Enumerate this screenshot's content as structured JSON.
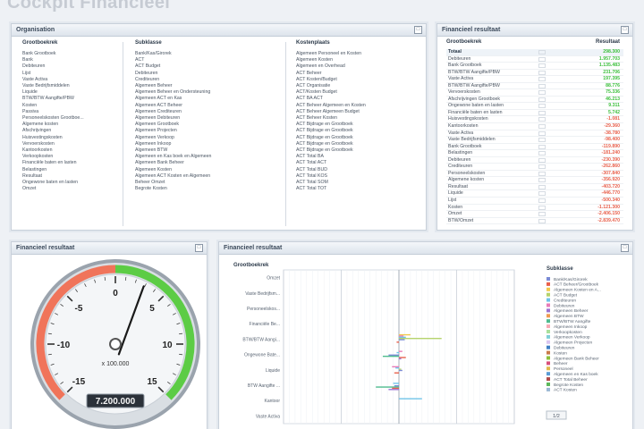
{
  "page": {
    "title": "Cockpit Financieel"
  },
  "organisation": {
    "title": "Organisation",
    "columns": [
      {
        "header": "Grootboekrek",
        "items": [
          "Bank Grootboek",
          "Bank",
          "Debiteuren",
          "Lijst",
          "Vaste Activa",
          "Vaste Bedrijfsmiddelen",
          "Liquide",
          "BTW/BTW Aangifte/PBW",
          "Kosten",
          "Passiva",
          "Personeelskosten Grootboe...",
          "Algemene kosten",
          "Afschrijvingen",
          "Huisvestingskosten",
          "Vervoerskosten",
          "Kantoorkosten",
          "Verkoopkosten",
          "Financiële baten en lasten",
          "Belastingen",
          "Resultaat",
          "Ongewone baten en lasten",
          "Omzet"
        ]
      },
      {
        "header": "Subklasse",
        "items": [
          "Bank/Kas/Girorek",
          "ACT",
          "ACT Budget",
          "Debiteuren",
          "Crediteuren",
          "Algemeen Beheer",
          "Algemeen Beheer en Ondersteuning",
          "Algemeen ACT en Kas",
          "Algemeen ACT Beheer",
          "Algemeen Crediteuren",
          "Algemeen Debiteuren",
          "Algemeen Grootboek",
          "Algemeen Projecten",
          "Algemeen Verkoop",
          "Algemeen Inkoop",
          "Algemeen BTW",
          "Algemeen en Kas boek en Algemeen",
          "Algemeen Bank Beheer",
          "Algemeen Kosten",
          "Algemeen ACT Kosten en Algemeen",
          "Beheer Omzet",
          "Begrote Kosten"
        ]
      },
      {
        "header": "Kostenplaats",
        "items": [
          "Algemeen Personeel en Kosten",
          "Algemeen Kosten",
          "Algemeen en Overhead",
          "ACT Beheer",
          "ACT Kosten/Budget",
          "ACT Organisatie",
          "ACT/Kosten Budget",
          "ACT BA ACT",
          "ACT Beheer Algemeen en Kosten",
          "ACT Beheer Algemeen Budget",
          "ACT Beheer Kosten",
          "ACT Bijdrage en Grootboek",
          "ACT Bijdrage en Grootboek",
          "ACT Bijdrage en Grootboek",
          "ACT Bijdrage en Grootboek",
          "ACT Bijdrage en Grootboek",
          "ACT Total BA",
          "ACT Total ACT",
          "ACT Total BUD",
          "ACT Total KOS",
          "ACT Total SOM",
          "ACT Total TOT"
        ]
      }
    ],
    "maximize_glyph": "□"
  },
  "result_list": {
    "title": "Financieel resultaat",
    "col_account": "Grootboekrek",
    "col_value": "Resultaat",
    "rows": [
      {
        "label": "Totaal",
        "value": "298.300",
        "color": "#3cbf3c",
        "total": true
      },
      {
        "label": "Debiteuren",
        "value": "1.957.703",
        "color": "#3cbf3c"
      },
      {
        "label": "Bank Grootboek",
        "value": "1.135.483",
        "color": "#3cbf3c"
      },
      {
        "label": "BTW/BTW Aangifte/PBW",
        "value": "231.706",
        "color": "#3cbf3c"
      },
      {
        "label": "Vaste Activa",
        "value": "197.395",
        "color": "#3cbf3c"
      },
      {
        "label": "BTW/BTW Aangifte/PBW",
        "value": "88.776",
        "color": "#3cbf3c"
      },
      {
        "label": "Vervoerskosten",
        "value": "75.336",
        "color": "#3cbf3c"
      },
      {
        "label": "Afschrijvingen Grootboek",
        "value": "46.213",
        "color": "#3cbf3c"
      },
      {
        "label": "Ongewone baten en lasten",
        "value": "9.311",
        "color": "#3cbf3c"
      },
      {
        "label": "Financiële baten en lasten",
        "value": "5.742",
        "color": "#3cbf3c"
      },
      {
        "label": "Huisvestingskosten",
        "value": "-1.081",
        "color": "#e8604c"
      },
      {
        "label": "Kantoorkosten",
        "value": "-29.360",
        "color": "#e8604c"
      },
      {
        "label": "Vaste Activa",
        "value": "-38.780",
        "color": "#e8604c"
      },
      {
        "label": "Vaste Bedrijfsmiddelen",
        "value": "-98.400",
        "color": "#e8604c"
      },
      {
        "label": "Bank Grootboek",
        "value": "-119.890",
        "color": "#e8604c"
      },
      {
        "label": "Belastingen",
        "value": "-181.240",
        "color": "#e8604c"
      },
      {
        "label": "Debiteuren",
        "value": "-230.390",
        "color": "#e8604c"
      },
      {
        "label": "Crediteuren",
        "value": "-262.860",
        "color": "#e8604c"
      },
      {
        "label": "Personeelskosten",
        "value": "-307.840",
        "color": "#e8604c"
      },
      {
        "label": "Algemene kosten",
        "value": "-356.920",
        "color": "#e8604c"
      },
      {
        "label": "Resultaat",
        "value": "-403.720",
        "color": "#e8604c"
      },
      {
        "label": "Liquide",
        "value": "-446.770",
        "color": "#e8604c"
      },
      {
        "label": "Lijst",
        "value": "-500.340",
        "color": "#e8604c"
      },
      {
        "label": "Kosten",
        "value": "-1.121.300",
        "color": "#e8604c"
      },
      {
        "label": "Omzet",
        "value": "-2.406.150",
        "color": "#e8604c"
      },
      {
        "label": "BTW/Omzet",
        "value": "-2.839.470",
        "color": "#e8604c"
      }
    ]
  },
  "gauge": {
    "title": "Financieel resultaat",
    "ticks": [
      "-15",
      "-10",
      "-5",
      "0",
      "5",
      "10",
      "15"
    ],
    "multiplier": "x 100.000",
    "readout": "7.200.000",
    "value": 2.9,
    "min": -15,
    "max": 15,
    "colors": {
      "negative": "#f0745a",
      "positive": "#5ccc45"
    }
  },
  "bar_chart": {
    "title": "Financieel resultaat",
    "category_header": "Grootboekrek",
    "legend_header": "Subklasse",
    "legend_items": [
      {
        "name": "Bank/Kas/Girorek",
        "color": "#7b8bd6"
      },
      {
        "name": "ACT Beheer/Grootboek",
        "color": "#e8604c"
      },
      {
        "name": "Algemeen Kosten en A...",
        "color": "#f2c94c"
      },
      {
        "name": "ACT Budget",
        "color": "#b5d36b"
      },
      {
        "name": "Crediteuren",
        "color": "#6fc3e8"
      },
      {
        "name": "Debiteuren",
        "color": "#e87bb8"
      },
      {
        "name": "Algemeen Beheer",
        "color": "#9b73d2"
      },
      {
        "name": "Algemeen BTW",
        "color": "#ef9b4f"
      },
      {
        "name": "BTW/BTW Aangifte",
        "color": "#4ebb8e"
      },
      {
        "name": "Algemeen Inkoop",
        "color": "#f6a9b4"
      },
      {
        "name": "Verkoopkosten",
        "color": "#a9e09c"
      },
      {
        "name": "Algemeen Verkoop",
        "color": "#7fcfd8"
      },
      {
        "name": "Algemeen Projecten",
        "color": "#d9c6f0"
      },
      {
        "name": "Debiteuren",
        "color": "#3f7fc4"
      },
      {
        "name": "Kosten",
        "color": "#c97a4a"
      },
      {
        "name": "Algemeen Bank Beheer",
        "color": "#8cbf3a"
      },
      {
        "name": "Beheer",
        "color": "#d84f7a"
      },
      {
        "name": "Personeel",
        "color": "#e0b84a"
      },
      {
        "name": "Algemeen en Kas boek",
        "color": "#5a9bd5"
      },
      {
        "name": "ACT Total Beheer",
        "color": "#b04a4a"
      },
      {
        "name": "Begrote Kosten",
        "color": "#5cb85c"
      },
      {
        "name": "ACT Kosten",
        "color": "#9bb7d4"
      }
    ],
    "legend_footer": "1/2"
  },
  "chart_data": {
    "type": "bar",
    "orientation": "horizontal",
    "categories": [
      "Omzet",
      "Vaste Bedrijfsm...",
      "Personeelskos...",
      "Financiële Be...",
      "BTW/BTW Aangi...",
      "Ongewone Bate...",
      "Liquide",
      "BTW Aangifte ...",
      "Kantoor",
      "Vaste Activa"
    ],
    "xlim": [
      -10,
      10
    ],
    "grid": true,
    "legend": "right",
    "series_values": [
      {
        "color": "#f2c94c",
        "values": [
          0,
          0,
          0,
          0,
          1.0,
          0,
          0,
          0,
          0,
          0
        ]
      },
      {
        "color": "#e87bb8",
        "values": [
          0,
          0,
          0,
          0,
          0.4,
          0.3,
          -0.6,
          0,
          0,
          0
        ]
      },
      {
        "color": "#6fc3e8",
        "values": [
          0,
          0,
          0,
          0,
          0.6,
          -0.2,
          -0.3,
          -0.5,
          2.0,
          0
        ]
      },
      {
        "color": "#b5d36b",
        "values": [
          0,
          0,
          0,
          0,
          3.7,
          0,
          0.2,
          0,
          0,
          0
        ]
      },
      {
        "color": "#7b8bd6",
        "values": [
          0,
          0,
          0,
          0,
          0.5,
          -0.9,
          0.3,
          -0.4,
          0,
          0
        ]
      },
      {
        "color": "#4ebb8e",
        "values": [
          0,
          0,
          0,
          0,
          0,
          -1.4,
          0,
          -2.0,
          0,
          0
        ]
      },
      {
        "color": "#e8604c",
        "values": [
          0,
          0,
          0,
          0,
          -0.2,
          0.6,
          -0.4,
          -0.6,
          0,
          0
        ]
      },
      {
        "color": "#9b73d2",
        "values": [
          0,
          0,
          0,
          0,
          0,
          0.2,
          0,
          -0.9,
          0,
          0
        ]
      }
    ]
  }
}
